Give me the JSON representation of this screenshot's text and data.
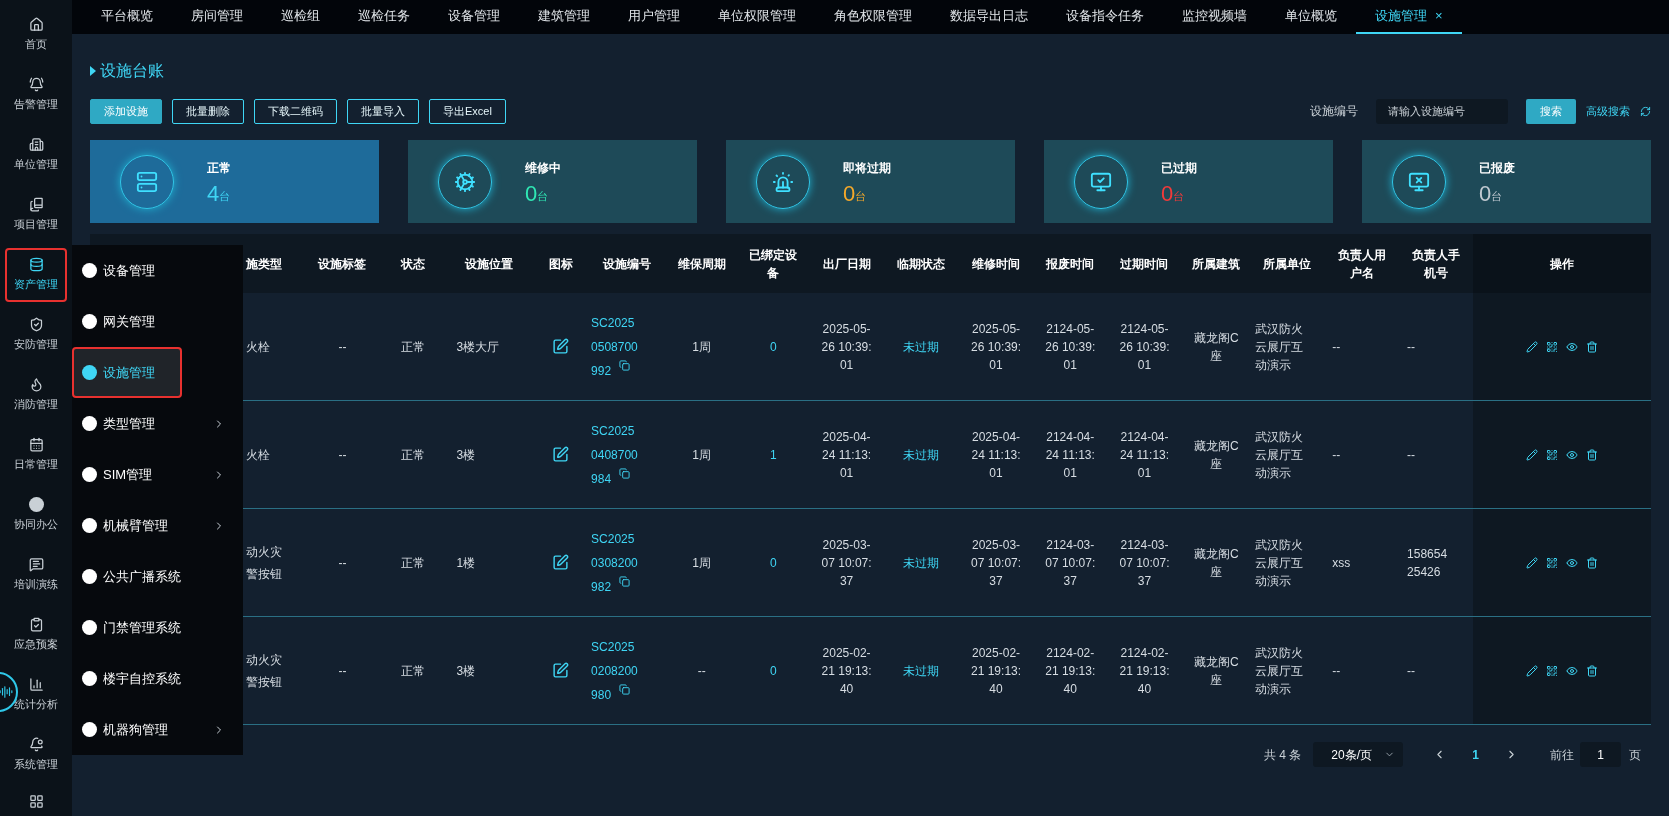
{
  "sidebar": {
    "items": [
      {
        "label": "首页",
        "selected": false,
        "annotated": false
      },
      {
        "label": "告警管理",
        "selected": false,
        "annotated": false
      },
      {
        "label": "单位管理",
        "selected": false,
        "annotated": false
      },
      {
        "label": "项目管理",
        "selected": false,
        "annotated": false
      },
      {
        "label": "资产管理",
        "selected": true,
        "annotated": true
      },
      {
        "label": "安防管理",
        "selected": false,
        "annotated": false
      },
      {
        "label": "消防管理",
        "selected": false,
        "annotated": false
      },
      {
        "label": "日常管理",
        "selected": false,
        "annotated": false
      },
      {
        "label": "协同办公",
        "selected": false,
        "annotated": false
      },
      {
        "label": "培训演练",
        "selected": false,
        "annotated": false
      },
      {
        "label": "应急预案",
        "selected": false,
        "annotated": false
      },
      {
        "label": "统计分析",
        "selected": false,
        "annotated": false
      },
      {
        "label": "系统管理",
        "selected": false,
        "annotated": false
      }
    ]
  },
  "submenu": {
    "items": [
      {
        "label": "设备管理",
        "selected": false,
        "annotated": false,
        "has_submenu": false
      },
      {
        "label": "网关管理",
        "selected": false,
        "annotated": false,
        "has_submenu": false
      },
      {
        "label": "设施管理",
        "selected": true,
        "annotated": true,
        "has_submenu": false
      },
      {
        "label": "类型管理",
        "selected": false,
        "annotated": false,
        "has_submenu": true
      },
      {
        "label": "SIM管理",
        "selected": false,
        "annotated": false,
        "has_submenu": true
      },
      {
        "label": "机械臂管理",
        "selected": false,
        "annotated": false,
        "has_submenu": true
      },
      {
        "label": "公共广播系统",
        "selected": false,
        "annotated": false,
        "has_submenu": false
      },
      {
        "label": "门禁管理系统",
        "selected": false,
        "annotated": false,
        "has_submenu": false
      },
      {
        "label": "楼宇自控系统",
        "selected": false,
        "annotated": false,
        "has_submenu": false
      },
      {
        "label": "机器狗管理",
        "selected": false,
        "annotated": false,
        "has_submenu": true
      }
    ]
  },
  "tabs": [
    {
      "label": "平台概览",
      "selected": false,
      "closable": false
    },
    {
      "label": "房间管理",
      "selected": false,
      "closable": false
    },
    {
      "label": "巡检组",
      "selected": false,
      "closable": false
    },
    {
      "label": "巡检任务",
      "selected": false,
      "closable": false
    },
    {
      "label": "设备管理",
      "selected": false,
      "closable": false
    },
    {
      "label": "建筑管理",
      "selected": false,
      "closable": false
    },
    {
      "label": "用户管理",
      "selected": false,
      "closable": false
    },
    {
      "label": "单位权限管理",
      "selected": false,
      "closable": false
    },
    {
      "label": "角色权限管理",
      "selected": false,
      "closable": false
    },
    {
      "label": "数据导出日志",
      "selected": false,
      "closable": false
    },
    {
      "label": "设备指令任务",
      "selected": false,
      "closable": false
    },
    {
      "label": "监控视频墙",
      "selected": false,
      "closable": false
    },
    {
      "label": "单位概览",
      "selected": false,
      "closable": false
    },
    {
      "label": "设施管理",
      "selected": true,
      "closable": true,
      "close": "×"
    }
  ],
  "page_title": "设施台账",
  "toolbar": {
    "buttons": [
      {
        "label": "添加设施",
        "kind": "primary"
      },
      {
        "label": "批量删除",
        "kind": "outline"
      },
      {
        "label": "下载二维码",
        "kind": "outline"
      },
      {
        "label": "批量导入",
        "kind": "outline"
      },
      {
        "label": "导出Excel",
        "kind": "outline"
      }
    ],
    "search_label": "设施编号",
    "search_placeholder": "请输入设施编号",
    "search_button": "搜索",
    "advanced_search": "高级搜索"
  },
  "stats": [
    {
      "label": "正常",
      "value": "4",
      "unit": "台",
      "color": "#3fd6f5",
      "selected": true
    },
    {
      "label": "维修中",
      "value": "0",
      "unit": "台",
      "color": "#2fe8b4",
      "selected": false
    },
    {
      "label": "即将过期",
      "value": "0",
      "unit": "台",
      "color": "#f5a92a",
      "selected": false
    },
    {
      "label": "已过期",
      "value": "0",
      "unit": "台",
      "color": "#f23a3a",
      "selected": false
    },
    {
      "label": "已报废",
      "value": "0",
      "unit": "台",
      "color": "#c2cad2",
      "selected": false
    }
  ],
  "table": {
    "columns": [
      "施类型",
      "设施标签",
      "状态",
      "设施位置",
      "图标",
      "设施编号",
      "维保周期",
      "已绑定设备",
      "出厂日期",
      "临期状态",
      "维修时间",
      "报废时间",
      "过期时间",
      "所属建筑",
      "所属单位",
      "负责人用户名",
      "负责人手机号",
      "操作"
    ],
    "rows": [
      {
        "type_lines": [
          "火栓"
        ],
        "tag": "--",
        "status": "正常",
        "location": "3楼大厅",
        "code": "SC20250508700992",
        "period": "1周",
        "bound": "0",
        "factory_date": "2025-05-26 10:39:01",
        "expiry_state": "未过期",
        "repair_time": "2025-05-26 10:39:01",
        "scrap_time": "2124-05-26 10:39:01",
        "expire_time": "2124-05-26 10:39:01",
        "building": "藏龙阁C座",
        "unit": "武汉防火云展厅互动演示",
        "user": "--",
        "phone": "--"
      },
      {
        "type_lines": [
          "火栓"
        ],
        "tag": "--",
        "status": "正常",
        "location": "3楼",
        "code": "SC20250408700984",
        "period": "1周",
        "bound": "1",
        "factory_date": "2025-04-24 11:13:01",
        "expiry_state": "未过期",
        "repair_time": "2025-04-24 11:13:01",
        "scrap_time": "2124-04-24 11:13:01",
        "expire_time": "2124-04-24 11:13:01",
        "building": "藏龙阁C座",
        "unit": "武汉防火云展厅互动演示",
        "user": "--",
        "phone": "--"
      },
      {
        "type_lines": [
          "动火灾",
          "警按钮"
        ],
        "tag": "--",
        "status": "正常",
        "location": "1楼",
        "code": "SC20250308200982",
        "period": "1周",
        "bound": "0",
        "factory_date": "2025-03-07 10:07:37",
        "expiry_state": "未过期",
        "repair_time": "2025-03-07 10:07:37",
        "scrap_time": "2124-03-07 10:07:37",
        "expire_time": "2124-03-07 10:07:37",
        "building": "藏龙阁C座",
        "unit": "武汉防火云展厅互动演示",
        "user": "xss",
        "phone": "15865425426"
      },
      {
        "type_lines": [
          "动火灾",
          "警按钮"
        ],
        "tag": "--",
        "status": "正常",
        "location": "3楼",
        "code": "SC20250208200980",
        "period": "--",
        "bound": "0",
        "factory_date": "2025-02-21 19:13:40",
        "expiry_state": "未过期",
        "repair_time": "2025-02-21 19:13:40",
        "scrap_time": "2124-02-21 19:13:40",
        "expire_time": "2124-02-21 19:13:40",
        "building": "藏龙阁C座",
        "unit": "武汉防火云展厅互动演示",
        "user": "--",
        "phone": "--"
      }
    ]
  },
  "pagination": {
    "total": "共 4 条",
    "page_size": "20条/页",
    "pages": [
      {
        "label": "1",
        "selected": true
      }
    ],
    "goto_label": "前往",
    "goto_value": "1",
    "goto_suffix": "页"
  }
}
